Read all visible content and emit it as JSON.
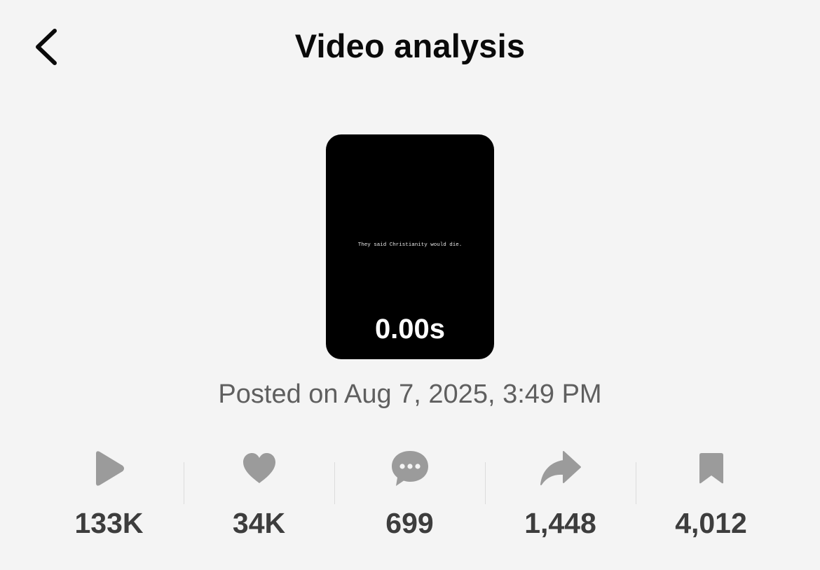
{
  "header": {
    "title": "Video analysis",
    "back_icon": "chevron-left-icon"
  },
  "video": {
    "caption": "They said Christianity would die.",
    "timestamp": "0.00s"
  },
  "posted_text": "Posted on Aug 7, 2025, 3:49 PM",
  "stats": [
    {
      "icon": "play-icon",
      "value": "133K"
    },
    {
      "icon": "heart-icon",
      "value": "34K"
    },
    {
      "icon": "comment-icon",
      "value": "699"
    },
    {
      "icon": "share-icon",
      "value": "1,448"
    },
    {
      "icon": "bookmark-icon",
      "value": "4,012"
    }
  ],
  "colors": {
    "background": "#f4f4f4",
    "icon_gray": "#9b9b9b",
    "value_text": "#3d3d3d"
  }
}
